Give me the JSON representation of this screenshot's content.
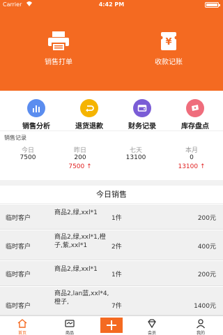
{
  "status_bar": {
    "carrier": "Carrier",
    "time": "4:42 PM"
  },
  "hero": {
    "print_label": "销售打单",
    "collect_label": "收款记账",
    "print_icon": "printer-icon",
    "collect_icon": "yen-receipt-icon"
  },
  "quick_actions": [
    {
      "label": "销售分析",
      "icon": "bar-chart-icon",
      "color": "#5b8def"
    },
    {
      "label": "退货退款",
      "icon": "return-icon",
      "color": "#f5b400"
    },
    {
      "label": "财务记录",
      "icon": "wallet-icon",
      "color": "#7a5cd6"
    },
    {
      "label": "库存盘点",
      "icon": "ticket-icon",
      "color": "#ef6d7c"
    }
  ],
  "sales_records": {
    "title": "销售记录",
    "columns": [
      {
        "header": "今日",
        "value": "7500",
        "compare": ""
      },
      {
        "header": "昨日",
        "value": "200",
        "compare": "7500 ↑"
      },
      {
        "header": "七天",
        "value": "13100",
        "compare": ""
      },
      {
        "header": "本月",
        "value": "0",
        "compare": "13100 ↑"
      }
    ]
  },
  "today_sales": {
    "title": "今日销售",
    "rows": [
      {
        "customer": "临时客户",
        "product": "商品2,绿,xxl*1",
        "qty": "1件",
        "amount": "200元"
      },
      {
        "customer": "临时客户",
        "product": "商品2,绿,xxl*1,橙子,紫,xxl*1",
        "qty": "2件",
        "amount": "400元"
      },
      {
        "customer": "临时客户",
        "product": "商品2,绿,xxl*1",
        "qty": "1件",
        "amount": "200元"
      },
      {
        "customer": "临时客户",
        "product": "商品2,lan蓝,xxl*4,橙子,",
        "qty": "7件",
        "amount": "1400元"
      }
    ]
  },
  "tab_bar": {
    "tabs": [
      {
        "label": "首页",
        "icon": "home-icon",
        "active": true
      },
      {
        "label": "商品",
        "icon": "goods-icon"
      },
      {
        "label": "",
        "icon": "plus-icon"
      },
      {
        "label": "会员",
        "icon": "diamond-icon"
      },
      {
        "label": "我的",
        "icon": "person-icon"
      }
    ]
  },
  "colors": {
    "accent": "#f46a21",
    "increase": "#e02020"
  }
}
